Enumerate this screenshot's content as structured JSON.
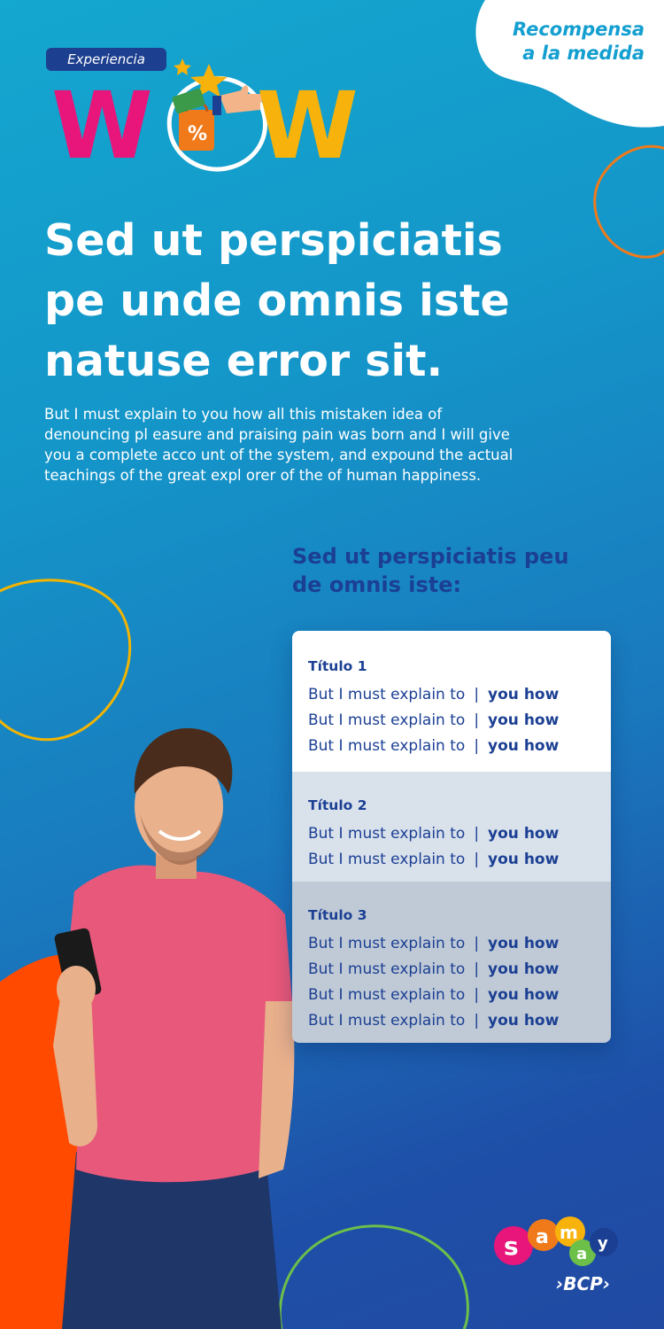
{
  "colors": {
    "background_top": "#14a7cf",
    "background_bottom": "#214aa3",
    "navy": "#1b3f93",
    "corner_tag": "#139fd0",
    "orange_ring": "#f07a1a",
    "yellow_ring": "#f2b400",
    "green_ring": "#6cc04a",
    "orange_blob": "#ff4a00",
    "wow_pink": "#e8157a",
    "wow_yellow": "#f7b20b",
    "shirt": "#e8587a"
  },
  "corner_tag": {
    "line1": "Recompensa",
    "line2": "a la medida"
  },
  "logo": {
    "chip": "Experiencia",
    "letter_left": "W",
    "letter_right": "W",
    "badge": "%"
  },
  "hero": {
    "title_line1": "Sed ut perspiciatis",
    "title_line2": "pe unde omnis iste",
    "title_line3": "natuse error sit.",
    "intro_line1": "But I must explain to you how all this mistaken idea of",
    "intro_line2": "denouncing pl easure and praising pain was born and I will give",
    "intro_line3": "you a complete acco unt of the system, and expound the actual",
    "intro_line4": "teachings of the great expl orer of the of human happiness."
  },
  "subtitle": {
    "line1": "Sed ut perspiciatis peu",
    "line2": "de omnis iste:"
  },
  "card": {
    "sections": [
      {
        "title": "Título 1",
        "rows": [
          {
            "label": "But I must explain to",
            "sep": "|",
            "value": "you how"
          },
          {
            "label": "But I must explain to",
            "sep": "|",
            "value": "you how"
          },
          {
            "label": "But I must explain to",
            "sep": "|",
            "value": "you how"
          }
        ]
      },
      {
        "title": "Título 2",
        "rows": [
          {
            "label": "But I must explain to",
            "sep": "|",
            "value": "you how"
          },
          {
            "label": "But I must explain to",
            "sep": "|",
            "value": "you how"
          }
        ]
      },
      {
        "title": "Título 3",
        "rows": [
          {
            "label": "But I must explain to",
            "sep": "|",
            "value": "you how"
          },
          {
            "label": "But I must explain to",
            "sep": "|",
            "value": "you how"
          },
          {
            "label": "But I must explain to",
            "sep": "|",
            "value": "you how"
          },
          {
            "label": "But I must explain to",
            "sep": "|",
            "value": "you how"
          }
        ]
      }
    ]
  },
  "brand": {
    "logo_letters": [
      "s",
      "a",
      "m",
      "a",
      "y"
    ],
    "bank": "›BCP›"
  }
}
